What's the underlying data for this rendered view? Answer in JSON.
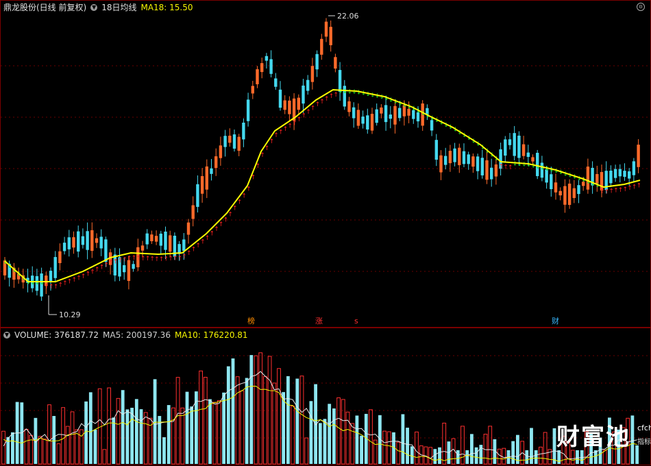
{
  "price_header": {
    "stock": "鼎龙股份(日线 前复权)",
    "indicator": "18日均线",
    "ma18_label": "MA18: 15.50"
  },
  "volume_header": {
    "volume_label": "VOLUME: 376187.72",
    "ma5_label": "MA5: 200197.36",
    "ma10_label": "MA10: 176220.81"
  },
  "annotations": {
    "high_price": "22.06",
    "low_price": "10.29"
  },
  "markers": [
    {
      "text": "榜",
      "color": "#ff8c00"
    },
    {
      "text": "涨",
      "color": "#ff3030"
    },
    {
      "text": "s",
      "color": "#ff3030"
    },
    {
      "text": "财",
      "color": "#39b8ff"
    }
  ],
  "watermark": {
    "brand": "财富池",
    "domain": "cfchi.com",
    "slogan": "指标交易平台"
  },
  "colors": {
    "background": "#000000",
    "up": "#ff6a2a",
    "down": "#44d8ee",
    "ma_line": "#ffff00",
    "grid": "#6a0000"
  },
  "chart_data": {
    "type": "candlestick",
    "price_range": [
      10.29,
      22.06
    ],
    "ma18": 15.5,
    "volume": 376187.72,
    "volume_ma5": 200197.36,
    "volume_ma10": 176220.81,
    "highest": 22.06,
    "lowest": 10.29
  }
}
